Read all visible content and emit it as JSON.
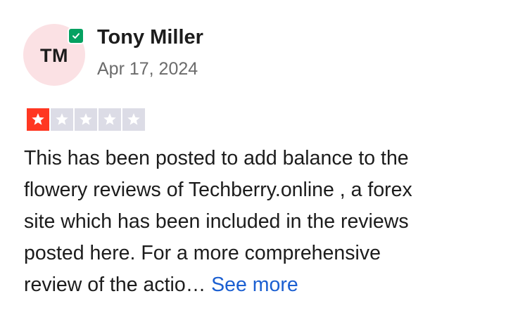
{
  "reviewer": {
    "initials": "TM",
    "name": "Tony Miller",
    "date": "Apr 17, 2024",
    "verified": true
  },
  "rating": {
    "value": 1,
    "max": 5
  },
  "review": {
    "text_lines": [
      "This has been posted to add balance to the",
      "flowery reviews of Techberry.online , a forex",
      "site which has been included in the reviews",
      "posted here. For a more comprehensive",
      "review of the actio…"
    ],
    "see_more_label": "See more"
  },
  "colors": {
    "avatar_bg": "#fbe1e4",
    "verified_badge": "#04a161",
    "star_filled": "#ff3722",
    "star_empty": "#dcdce6",
    "link": "#1b5fd1"
  },
  "icons": {
    "verified": "checkmark-icon",
    "star": "star-icon"
  }
}
